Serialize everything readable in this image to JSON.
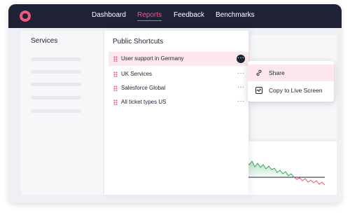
{
  "nav": {
    "items": [
      "Dashboard",
      "Reports",
      "Feedback",
      "Benchmarks"
    ],
    "active": "Reports"
  },
  "services": {
    "title": "Services"
  },
  "shortcuts": {
    "title": "Public Shortcuts",
    "items": [
      {
        "label": "User support in Germany",
        "selected": true
      },
      {
        "label": "UK Services"
      },
      {
        "label": "Salesforce Global"
      },
      {
        "label": "All ticket types US"
      }
    ]
  },
  "menu": {
    "items": [
      {
        "label": "Share",
        "icon": "link-icon"
      },
      {
        "label": "Copy to Live Screen",
        "icon": "live-screen-icon"
      }
    ]
  },
  "colors": {
    "topbar": "#1f2235",
    "accent": "#f0587d",
    "selected_bg": "#fbe7ec",
    "chart_green": "#38a55a",
    "chart_red": "#e45b6a"
  }
}
